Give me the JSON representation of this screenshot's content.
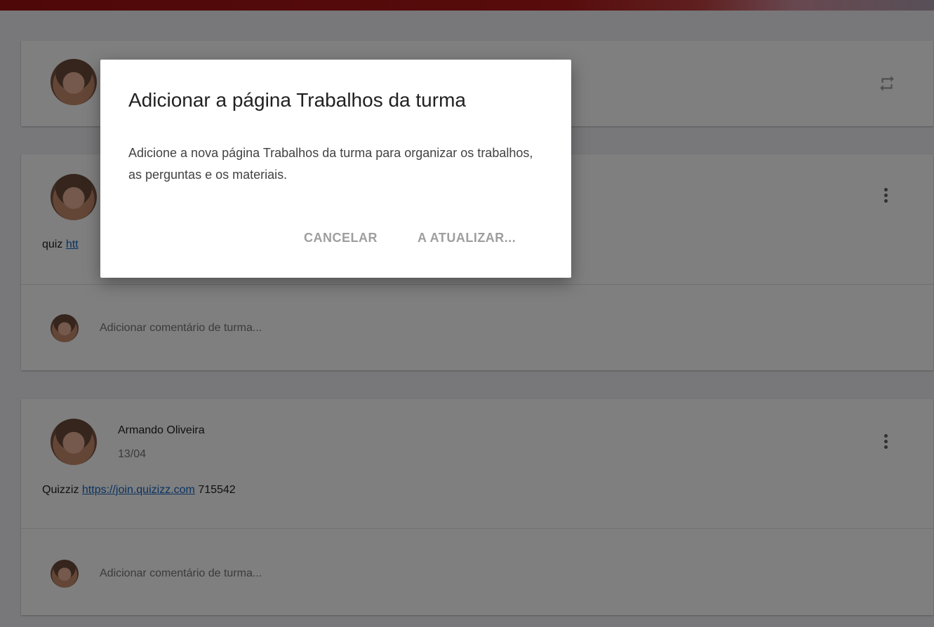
{
  "dialog": {
    "title": "Adicionar a página Trabalhos da turma",
    "body": "Adicione a nova página Trabalhos da turma para organizar os trabalhos, as perguntas e os materiais.",
    "cancel_label": "CANCELAR",
    "update_label": "A ATUALIZAR..."
  },
  "posts": [
    {
      "text_prefix": "quiz",
      "link_text": "htt",
      "comment_placeholder": "Adicionar comentário de turma..."
    },
    {
      "author": "Armando Oliveira",
      "date": "13/04",
      "text_prefix": "Quizziz",
      "link_text": "https://join.quizizz.com",
      "text_suffix": "715542",
      "comment_placeholder": "Adicionar comentário de turma..."
    }
  ],
  "icons": {
    "repeat": "repeat-icon",
    "more": "more-vert-icon"
  },
  "colors": {
    "link": "#1565c0",
    "scrim": "rgba(0,0,0,0.5)",
    "theme_bar": "#9e1010"
  }
}
